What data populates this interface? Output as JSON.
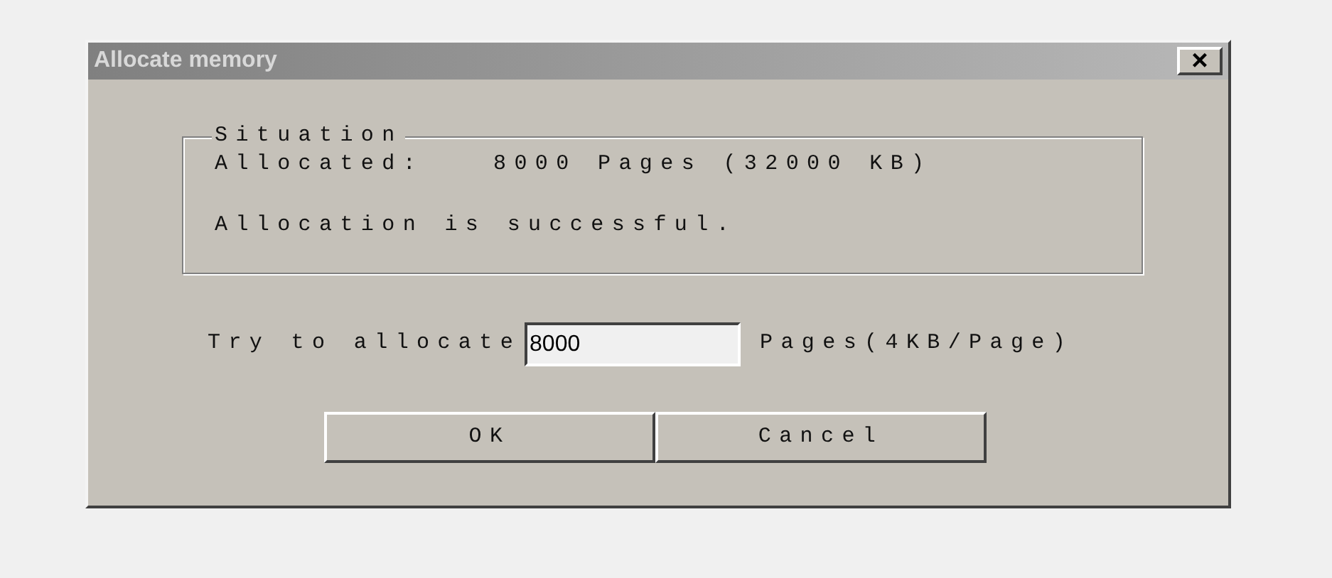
{
  "window": {
    "title": "Allocate memory",
    "close": "×"
  },
  "situation": {
    "legend": "Situation",
    "allocated_label": "Allocated:",
    "allocated_value": "8000 Pages (32000 KB)",
    "message": "Allocation is successful."
  },
  "allocate": {
    "label": "Try to allocate",
    "value": "8000",
    "unit": "Pages(4KB/Page)"
  },
  "buttons": [
    "OK",
    "Cancel"
  ]
}
